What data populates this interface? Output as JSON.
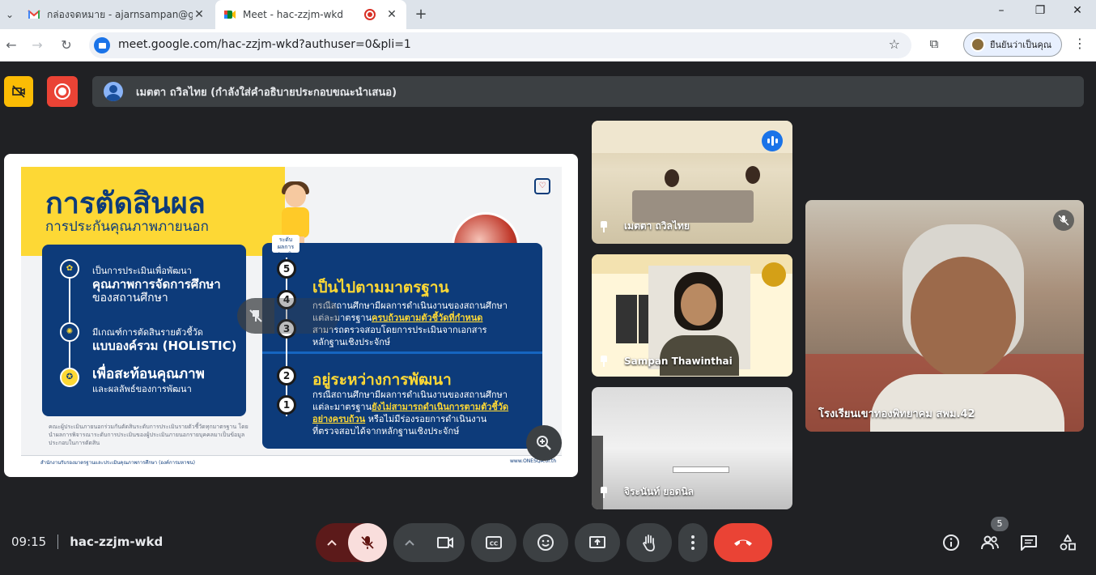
{
  "browser": {
    "tabs": [
      {
        "title": "กล่องจดหมาย - ajarnsampan@gmail.com",
        "close": "✕"
      },
      {
        "title": "Meet - hac-zzjm-wkd",
        "close": "✕"
      }
    ],
    "url": "meet.google.com/hac-zzjm-wkd?authuser=0&pli=1",
    "profile_label": "ยืนยันว่าเป็นคุณ"
  },
  "meet": {
    "caption_text": "เมตตา ถวิลไทย (กำลังใส่คำอธิบายประกอบขณะนำเสนอ)",
    "time": "09:15",
    "meeting_code": "hac-zzjm-wkd",
    "participants_count": "5"
  },
  "slide": {
    "title": "การตัดสินผล",
    "subtitle": "การประกันคุณภาพภายนอก",
    "level_tag": "ระดับ",
    "level_tag_sub": "ผลการประเมิน",
    "left_items": [
      {
        "line1": "เป็นการประเมินเพื่อพัฒนา",
        "line2": "คุณภาพการจัดการศึกษา",
        "line3": "ของสถานศึกษา"
      },
      {
        "line1": "มีเกณฑ์การตัดสินรายตัวชี้วัด",
        "line2": "แบบองค์รวม (HOLISTIC)"
      },
      {
        "line1": "เพื่อสะท้อนคุณภาพ",
        "line2": "และผลลัพธ์ของการพัฒนา"
      }
    ],
    "levels": [
      "5",
      "4",
      "3",
      "2",
      "1"
    ],
    "sec1": {
      "head": "เป็นไปตามมาตรฐาน",
      "l1": "กรณีสถานศึกษามีผลการดำเนินงานของสถานศึกษา",
      "l2a": "แต่ละมาตรฐาน",
      "l2b": "ครบถ้วนตามตัวชี้วัดที่กำหนด",
      "l3": "สามารถตรวจสอบโดยการประเมินจากเอกสาร",
      "l4": "หลักฐานเชิงประจักษ์"
    },
    "sec2": {
      "head": "อยู่ระหว่างการพัฒนา",
      "l1": "กรณีสถานศึกษามีผลการดำเนินงานของสถานศึกษา",
      "l2a": "แต่ละมาตรฐาน",
      "l2b": "ยังไม่สามารถดำเนินการตามตัวชี้วัด",
      "l3": "อย่างครบถ้วน",
      "l3b": " หรือไม่มีร่องรอยการดำเนินงาน",
      "l4": "ที่ตรวจสอบได้จากหลักฐานเชิงประจักษ์"
    },
    "note": "คณะผู้ประเมินภายนอกร่วมกันตัดสินระดับการประเมินรายตัวชี้วัดทุกมาตรฐาน โดยนำผลการพิจารณาระดับการประเมินของผู้ประเมินภายนอกรายบุคคลมาเป็นข้อมูลประกอบในการตัดสิน",
    "footer_left": "สำนักงานรับรองมาตรฐานและประเมินคุณภาพการศึกษา (องค์การมหาชน)",
    "footer_right": "www.ONESQA.or.th"
  },
  "tiles": [
    {
      "name": "เมตตา ถวิลไทย"
    },
    {
      "name": "Sampan Thawinthai"
    },
    {
      "name": "จิระนันท์ ยอดนิล"
    },
    {
      "name": "โรงเรียนเขาทองพิทยาคม สพม.42"
    }
  ]
}
